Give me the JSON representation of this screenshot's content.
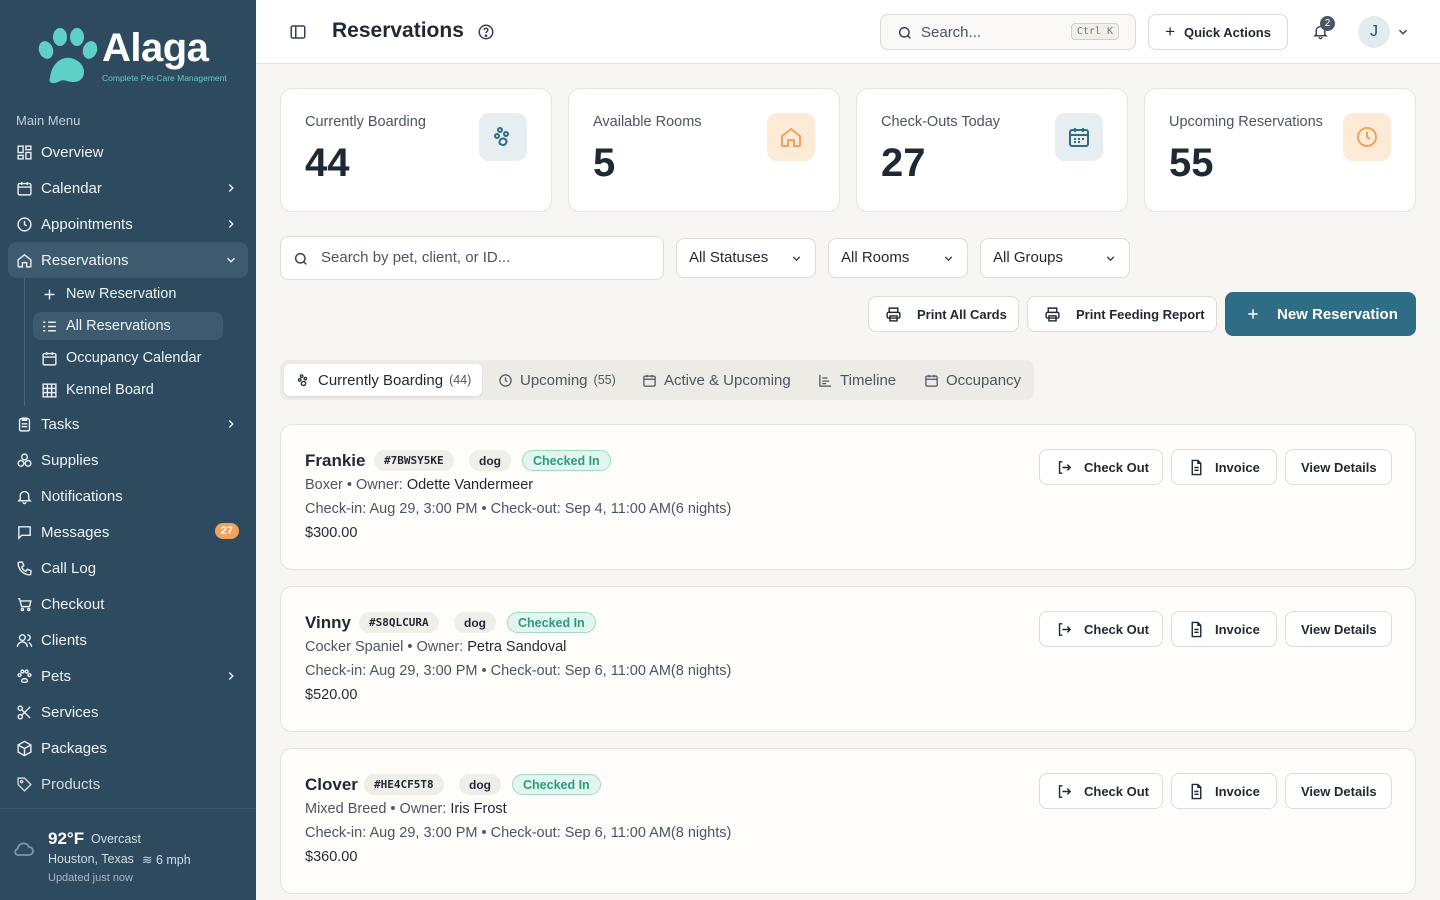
{
  "brand": {
    "name": "Alaga",
    "tagline": "Complete Pet-Care Management",
    "accent": "#2e6d85",
    "sidebar_bg": "#2e4a5e"
  },
  "sidebar": {
    "menu_label": "Main Menu",
    "items": [
      {
        "label": "Overview",
        "icon": "grid-icon"
      },
      {
        "label": "Calendar",
        "icon": "calendar-icon"
      },
      {
        "label": "Appointments",
        "icon": "clock-icon"
      },
      {
        "label": "Reservations",
        "icon": "home-icon"
      },
      {
        "label": "Tasks",
        "icon": "clipboard-icon"
      },
      {
        "label": "Supplies",
        "icon": "boxes-icon"
      },
      {
        "label": "Notifications",
        "icon": "bell-icon"
      },
      {
        "label": "Messages",
        "icon": "message-icon",
        "badge": "27"
      },
      {
        "label": "Call Log",
        "icon": "phone-icon"
      },
      {
        "label": "Checkout",
        "icon": "cart-icon"
      },
      {
        "label": "Clients",
        "icon": "users-icon"
      },
      {
        "label": "Pets",
        "icon": "paw-icon"
      },
      {
        "label": "Services",
        "icon": "scissors-icon"
      },
      {
        "label": "Packages",
        "icon": "package-icon"
      },
      {
        "label": "Products",
        "icon": "tag-icon"
      }
    ],
    "reservations_sub": [
      {
        "label": "New Reservation"
      },
      {
        "label": "All Reservations"
      },
      {
        "label": "Occupancy Calendar"
      },
      {
        "label": "Kennel Board"
      }
    ],
    "weather": {
      "temp": "92°F",
      "condition": "Overcast",
      "location": "Houston, Texas",
      "wind": "6 mph",
      "updated": "Updated just now"
    }
  },
  "header": {
    "title": "Reservations",
    "search_placeholder": "Search...",
    "shortcut": "Ctrl K",
    "quick_actions": "Quick Actions",
    "notification_count": "2",
    "avatar_initial": "J"
  },
  "stats": [
    {
      "label": "Currently Boarding",
      "value": "44",
      "icon": "paw-icon"
    },
    {
      "label": "Available Rooms",
      "value": "5",
      "icon": "home-icon"
    },
    {
      "label": "Check-Outs Today",
      "value": "27",
      "icon": "calendar-icon"
    },
    {
      "label": "Upcoming Reservations",
      "value": "55",
      "icon": "clock-icon"
    }
  ],
  "filters": {
    "search_placeholder": "Search by pet, client, or ID...",
    "status": "All Statuses",
    "rooms": "All Rooms",
    "groups": "All Groups"
  },
  "actions": {
    "print_cards": "Print All Cards",
    "print_feeding": "Print Feeding Report",
    "new_reservation": "New Reservation"
  },
  "tabs": [
    {
      "label": "Currently Boarding",
      "count": "(44)"
    },
    {
      "label": "Upcoming",
      "count": "(55)"
    },
    {
      "label": "Active & Upcoming"
    },
    {
      "label": "Timeline"
    },
    {
      "label": "Occupancy"
    }
  ],
  "reservations": [
    {
      "name": "Frankie",
      "id": "#7BWSY5KE",
      "species": "dog",
      "status": "Checked In",
      "breed": "Boxer",
      "owner_label": "Owner:",
      "owner": "Odette Vandermeer",
      "dates": "Check-in: Aug 29, 3:00 PM • Check-out: Sep 4, 11:00 AM(6 nights)",
      "price": "$300.00"
    },
    {
      "name": "Vinny",
      "id": "#S8QLCURA",
      "species": "dog",
      "status": "Checked In",
      "breed": "Cocker Spaniel",
      "owner_label": "Owner:",
      "owner": "Petra Sandoval",
      "dates": "Check-in: Aug 29, 3:00 PM • Check-out: Sep 6, 11:00 AM(8 nights)",
      "price": "$520.00"
    },
    {
      "name": "Clover",
      "id": "#HE4CF5T8",
      "species": "dog",
      "status": "Checked In",
      "breed": "Mixed Breed",
      "owner_label": "Owner:",
      "owner": "Iris Frost",
      "dates": "Check-in: Aug 29, 3:00 PM • Check-out: Sep 6, 11:00 AM(8 nights)",
      "price": "$360.00"
    }
  ],
  "card_actions": {
    "check_out": "Check Out",
    "invoice": "Invoice",
    "view_details": "View Details"
  }
}
